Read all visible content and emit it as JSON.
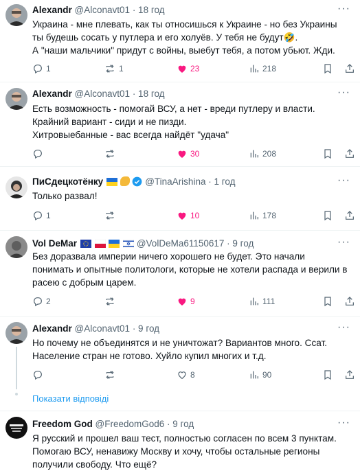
{
  "tweets": [
    {
      "name": "Alexandr",
      "handle": "@Alconavt01",
      "time": "· 18 год",
      "lines": [
        "Украина - мне плевать, как ты относишься к Украине - но без Украины",
        "ты будешь сосать у путлера и его холуёв. У тебя не будут🤣.",
        "А \"наши мальчики\" придут с войны, выебут тебя, а потом убьют. Жди."
      ],
      "replies": "1",
      "reposts": "1",
      "likes": "23",
      "views": "218"
    },
    {
      "name": "Alexandr",
      "handle": "@Alconavt01",
      "time": "· 18 год",
      "lines": [
        "Есть возможность  - помогай ВСУ,  а нет - вреди путлеру и власти.",
        "Крайний вариант - сиди и не пизди.",
        "Хитровыебанные - вас всегда найдёт \"удача\""
      ],
      "replies": "",
      "reposts": "",
      "likes": "30",
      "views": "208"
    },
    {
      "name": "ПиСдецкотёнку",
      "handle": "@TinaArishina",
      "time": "· 1 год",
      "lines": [
        "Только развал!"
      ],
      "replies": "1",
      "reposts": "",
      "likes": "10",
      "views": "178"
    },
    {
      "name": "Vol DeMar",
      "handle": "@VolDeMa61150617",
      "time": "· 9 год",
      "lines": [
        "Без доразвала империи ничего хорошего не будет. Это начали",
        "понимать и опытные политологи, которые не хотели распада и верили в",
        "расею с добрым царем."
      ],
      "replies": "2",
      "reposts": "",
      "likes": "9",
      "views": "111"
    },
    {
      "name": "Alexandr",
      "handle": "@Alconavt01",
      "time": "· 9 год",
      "lines": [
        "Но почему не объединятся и не уничтожат? Вариантов много. Ссат.",
        "Население стран не готово. Хуйло купил многих и т.д."
      ],
      "replies": "",
      "reposts": "",
      "likes": "8",
      "views": "90"
    },
    {
      "name": "Freedom God",
      "handle": "@FreedomGod6",
      "time": "· 9 год",
      "lines": [
        "Я русский и прошел ваш тест, полностью согласен по всем 3 пунктам.",
        "Помогаю ВСУ, ненавижу Москву и хочу, чтобы остальные регионы",
        "получили свободу. Что ещё?"
      ]
    }
  ],
  "show_replies": "Показати відповіді",
  "more_label": "···",
  "icons": {
    "reply": "reply-icon",
    "repost": "repost-icon",
    "like": "heart-icon",
    "views": "views-icon",
    "bookmark": "bookmark-icon",
    "share": "share-icon"
  },
  "colors": {
    "like": "#f91880",
    "link": "#1d9bf0",
    "muted": "#536471",
    "verified": "#1d9bf0"
  }
}
